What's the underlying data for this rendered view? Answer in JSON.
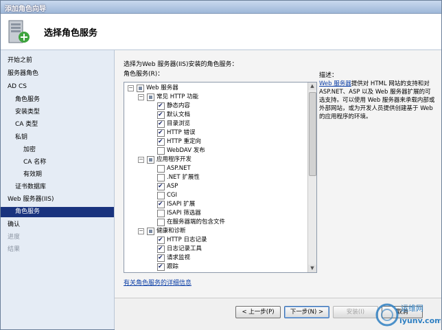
{
  "window": {
    "title": "添加角色向导"
  },
  "header": {
    "heading": "选择角色服务"
  },
  "sidebar": {
    "items": [
      {
        "label": "开始之前",
        "state": "normal"
      },
      {
        "label": "服务器角色",
        "state": "normal"
      },
      {
        "label": "AD CS",
        "state": "normal"
      },
      {
        "label": "角色服务",
        "state": "normal"
      },
      {
        "label": "安装类型",
        "state": "normal"
      },
      {
        "label": "CA 类型",
        "state": "normal"
      },
      {
        "label": "私钥",
        "state": "normal"
      },
      {
        "label": "加密",
        "state": "normal"
      },
      {
        "label": "CA 名称",
        "state": "normal"
      },
      {
        "label": "有效期",
        "state": "normal"
      },
      {
        "label": "证书数据库",
        "state": "normal"
      },
      {
        "label": "Web 服务器(IIS)",
        "state": "normal"
      },
      {
        "label": "角色服务",
        "state": "selected"
      },
      {
        "label": "确认",
        "state": "normal"
      },
      {
        "label": "进度",
        "state": "disabled"
      },
      {
        "label": "结果",
        "state": "disabled"
      }
    ]
  },
  "main": {
    "intro": "选择为Web 服务器(IIS)安装的角色服务：",
    "list_label": "角色服务(R)：",
    "tree": [
      {
        "label": "Web 服务器",
        "state": "partial",
        "expander": "−"
      },
      {
        "label": "常见 HTTP 功能",
        "state": "partial",
        "expander": "−"
      },
      {
        "label": "静态内容",
        "state": "checked"
      },
      {
        "label": "默认文档",
        "state": "checked"
      },
      {
        "label": "目录浏览",
        "state": "checked"
      },
      {
        "label": "HTTP 错误",
        "state": "checked"
      },
      {
        "label": "HTTP 重定向",
        "state": "checked"
      },
      {
        "label": "WebDAV 发布",
        "state": "unchecked"
      },
      {
        "label": "应用程序开发",
        "state": "partial",
        "expander": "−"
      },
      {
        "label": "ASP.NET",
        "state": "unchecked"
      },
      {
        "label": ".NET 扩展性",
        "state": "unchecked"
      },
      {
        "label": "ASP",
        "state": "checked"
      },
      {
        "label": "CGI",
        "state": "unchecked"
      },
      {
        "label": "ISAPI 扩展",
        "state": "checked"
      },
      {
        "label": "ISAPI 筛选器",
        "state": "unchecked"
      },
      {
        "label": "在服务器端的包含文件",
        "state": "unchecked"
      },
      {
        "label": "健康和诊断",
        "state": "partial",
        "expander": "−"
      },
      {
        "label": "HTTP 日志记录",
        "state": "checked"
      },
      {
        "label": "日志记录工具",
        "state": "checked"
      },
      {
        "label": "请求监视",
        "state": "checked"
      },
      {
        "label": "跟踪",
        "state": "checked"
      }
    ],
    "more_link": "有关角色服务的详细信息",
    "description": {
      "label": "描述：",
      "link": "Web 服务器",
      "text": "提供对 HTML 网站的支持和对 ASP.NET、ASP 以及 Web 服务器扩展的可选支持。可以使用 Web 服务器来承载内部或外部网站，或为开发人员提供创建基于 Web 的应用程序的环境。"
    }
  },
  "footer": {
    "back": "< 上一步(P)",
    "next": "下一步(N) >",
    "install": "安装(I)",
    "cancel": "取消"
  },
  "watermark": {
    "line1": "运维网",
    "line2": "iyunv.com"
  }
}
